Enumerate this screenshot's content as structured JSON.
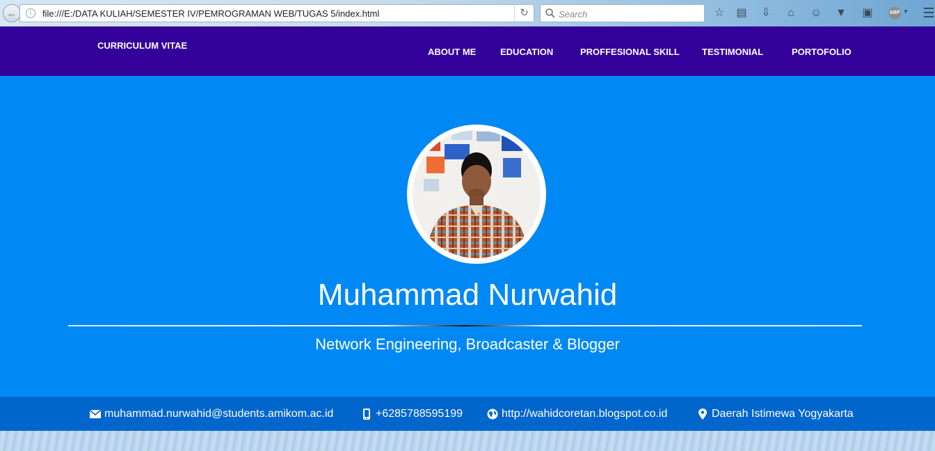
{
  "browser": {
    "url": "file:///E:/DATA KULIAH/SEMESTER IV/PEMROGRAMAN WEB/TUGAS 5/index.html",
    "search_placeholder": "Search",
    "toolbar_icons": [
      "bookmark-star-icon",
      "reading-list-icon",
      "download-icon",
      "home-icon",
      "smiley-icon",
      "pocket-icon",
      "screenshot-icon",
      "adblock-icon",
      "menu-icon"
    ],
    "adblock_label": "ABP"
  },
  "navbar": {
    "brand": "CURRICULUM VITAE",
    "items": [
      {
        "label": "ABOUT ME"
      },
      {
        "label": "EDUCATION"
      },
      {
        "label": "PROFFESIONAL SKILL"
      },
      {
        "label": "TESTIMONIAL"
      },
      {
        "label": "PORTOFOLIO"
      }
    ]
  },
  "hero": {
    "name": "Muhammad Nurwahid",
    "tagline": "Network Engineering, Broadcaster & Blogger"
  },
  "contact": {
    "email": "muhammad.nurwahid@students.amikom.ac.id",
    "phone": "+6285788595199",
    "website": "http://wahidcoretan.blogspot.co.id",
    "location": "Daerah Istimewa Yogyakarta"
  },
  "colors": {
    "navbar": "#330099",
    "hero": "#0088f5",
    "contact_bar": "#0066cc",
    "text": "#ffffff"
  }
}
